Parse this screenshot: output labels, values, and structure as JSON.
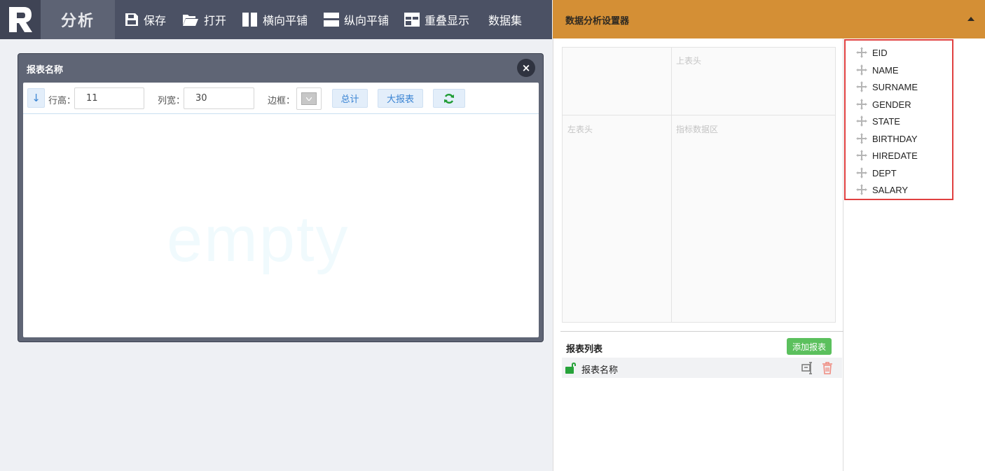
{
  "toolbar": {
    "logo_letter": "R",
    "app_title": "分析",
    "buttons": [
      {
        "label": "保存",
        "icon": "save-icon"
      },
      {
        "label": "打开",
        "icon": "folder-open-icon"
      },
      {
        "label": "横向平铺",
        "icon": "tile-horizontal-icon"
      },
      {
        "label": "纵向平铺",
        "icon": "tile-vertical-icon"
      },
      {
        "label": "重叠显示",
        "icon": "overlap-icon"
      },
      {
        "label": "数据集",
        "icon": ""
      }
    ]
  },
  "right_panel": {
    "title": "数据分析设置器",
    "collapse_icon": "caret-up-icon",
    "pivot": {
      "top_header": "上表头",
      "left_header": "左表头",
      "data_area": "指标数据区"
    },
    "fields": [
      "EID",
      "NAME",
      "SURNAME",
      "GENDER",
      "STATE",
      "BIRTHDAY",
      "HIREDATE",
      "DEPT",
      "SALARY"
    ],
    "report_list": {
      "title": "报表列表",
      "add_label": "添加报表",
      "items": [
        {
          "name": "报表名称"
        }
      ]
    }
  },
  "report_window": {
    "title": "报表名称",
    "close_label": "×",
    "sort_label": "↓",
    "row_height_label": "行高：",
    "row_height_value": "11",
    "col_width_label": "列宽：",
    "col_width_value": "30",
    "border_label": "边框：",
    "total_label": "总计",
    "big_report_label": "大报表",
    "refresh_icon": "refresh-icon",
    "empty_text": "empty"
  },
  "colors": {
    "toolbar_bg": "#4b5164",
    "accent_orange": "#d48f35",
    "highlight_red": "#e04040",
    "add_green": "#5bc05d",
    "button_blue": "#3a84d3"
  }
}
